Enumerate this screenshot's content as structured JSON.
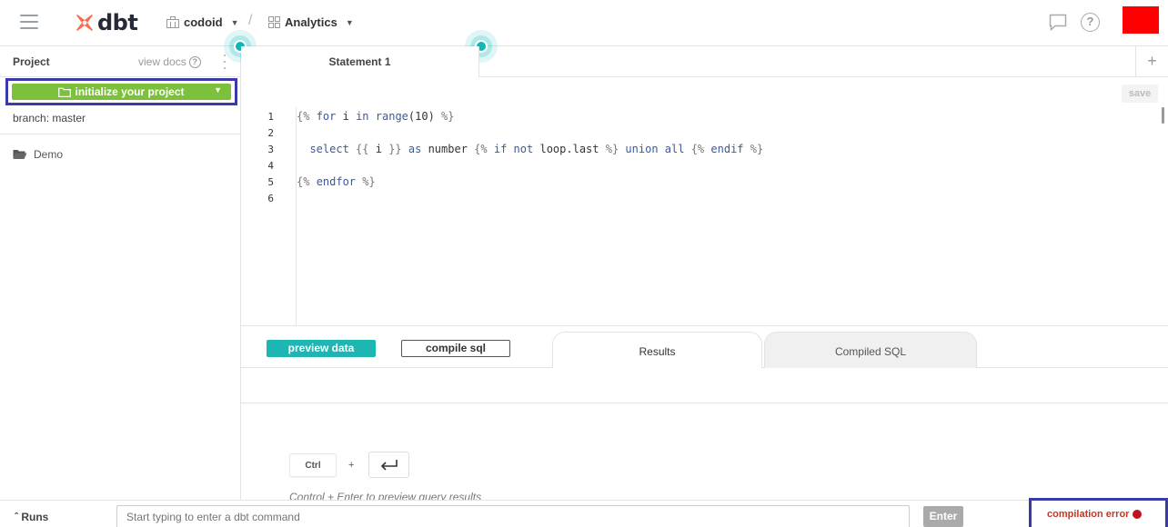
{
  "header": {
    "logo_text": "dbt",
    "account": "codoid",
    "separator": "/",
    "project": "Analytics"
  },
  "sidebar": {
    "title": "Project",
    "view_docs": "view docs",
    "help_glyph": "?",
    "init_button": "initialize your project",
    "branch": "branch: master",
    "tree": [
      {
        "label": "Demo",
        "icon": "folder-open-icon"
      }
    ]
  },
  "editor": {
    "tab": "Statement 1",
    "new_tab": "+",
    "save": "save",
    "line_numbers": [
      "1",
      "2",
      "3",
      "4",
      "5",
      "6"
    ],
    "lines": [
      "{% for i in range(10) %}",
      "",
      "  select {{ i }} as number {% if not loop.last %} union all {% endif %}",
      "",
      "{% endfor %}",
      ""
    ]
  },
  "results": {
    "preview_button": "preview data",
    "compile_button": "compile sql",
    "tabs": [
      "Results",
      "Compiled SQL"
    ],
    "shortcut_ctrl": "Ctrl",
    "shortcut_plus": "+",
    "hint": "Control + Enter to preview query results"
  },
  "footer": {
    "runs": "Runs",
    "command_placeholder": "Start typing to enter a dbt command",
    "enter": "Enter",
    "status": "compilation error"
  },
  "colors": {
    "accent_teal": "#1db6b3",
    "init_green": "#7cc13b",
    "error_red": "#c1121f",
    "highlight_border": "#3a3aa8",
    "avatar": "#ff0000"
  }
}
